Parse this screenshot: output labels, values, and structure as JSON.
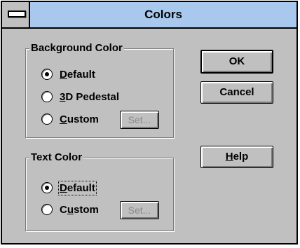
{
  "dialog": {
    "title": "Colors"
  },
  "background_group": {
    "title": "Background Color",
    "options": [
      {
        "label_mn": "D",
        "label_rest": "efault",
        "checked": true
      },
      {
        "label_mn": "3",
        "label_rest": "D Pedestal",
        "checked": false
      },
      {
        "label_mn": "C",
        "label_rest": "ustom",
        "checked": false
      }
    ],
    "set_label": "Set..."
  },
  "text_group": {
    "title": "Text Color",
    "options": [
      {
        "label_pre": "",
        "label_mn": "D",
        "label_rest": "efault",
        "checked": true
      },
      {
        "label_pre": "C",
        "label_mn": "u",
        "label_rest": "stom",
        "checked": false
      }
    ],
    "set_label": "Set..."
  },
  "buttons": {
    "ok": "OK",
    "cancel": "Cancel",
    "help_mn": "H",
    "help_rest": "elp"
  }
}
